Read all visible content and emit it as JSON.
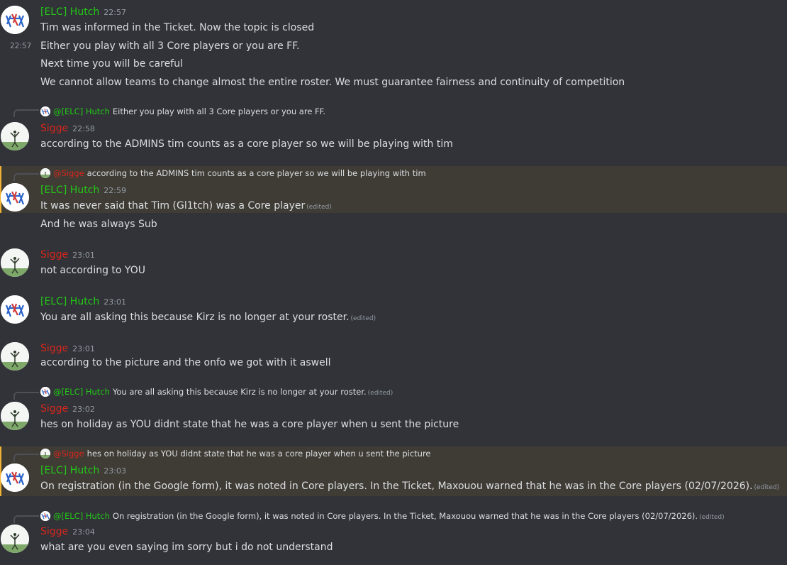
{
  "colors": {
    "hutch": "#23c916",
    "sigge": "#d6261c",
    "mention_bg": "#3f3c36"
  },
  "icons": {
    "hutch_avatar": "elc-logo-icon",
    "sigge_avatar": "person-field-icon"
  },
  "messages": [
    {
      "author": "[ELC] Hutch",
      "time": "22:57",
      "lines": [
        "Tim was informed in the Ticket. Now the topic is closed",
        "Either you play with all 3 Core players or you are FF.",
        "Next time you will be careful",
        "We cannot allow teams to change almost the entire roster. We must guarantee fairness and continuity of competition"
      ],
      "hover_time": "22:57"
    },
    {
      "reply": {
        "author": "@[ELC] Hutch",
        "text": "Either you play with all 3 Core players or you are FF."
      },
      "author": "Sigge",
      "time": "22:58",
      "lines": [
        "according to the ADMINS tim counts as a core player so we will be playing with tim"
      ]
    },
    {
      "reply": {
        "author": "@Sigge",
        "text": "according to the ADMINS tim counts as a core player so we will be playing with tim"
      },
      "author": "[ELC] Hutch",
      "time": "22:59",
      "lines": [
        "It was never said that Tim (Gl1tch) was a Core player",
        "And he was always Sub"
      ],
      "edited": "(edited)"
    },
    {
      "author": "Sigge",
      "time": "23:01",
      "lines": [
        "not according to YOU"
      ]
    },
    {
      "author": "[ELC] Hutch",
      "time": "23:01",
      "lines": [
        "You are all asking this because Kirz is no longer at your roster."
      ],
      "edited": "(edited)"
    },
    {
      "author": "Sigge",
      "time": "23:01",
      "lines": [
        "according to the picture and the onfo we got with it aswell"
      ]
    },
    {
      "reply": {
        "author": "@[ELC] Hutch",
        "text": "You are all asking this because Kirz is no longer at your roster.",
        "edited": "(edited)"
      },
      "author": "Sigge",
      "time": "23:02",
      "lines": [
        "hes on holiday as YOU didnt state that he was a core player when u sent the picture"
      ]
    },
    {
      "reply": {
        "author": "@Sigge",
        "text": "hes on holiday as YOU didnt state that he was a core player when u sent the picture"
      },
      "author": "[ELC] Hutch",
      "time": "23:03",
      "lines": [
        "On registration (in the Google form), it was noted in Core players. In the Ticket, Maxouou warned that he was in the Core players (02/07/2026)."
      ],
      "edited": "(edited)"
    },
    {
      "reply": {
        "author": "@[ELC] Hutch",
        "text": "On registration (in the Google form), it was noted in Core players. In the Ticket, Maxouou warned that he was in the Core players (02/07/2026).",
        "edited": "(edited)"
      },
      "author": "Sigge",
      "time": "23:04",
      "lines": [
        "what are you even saying im sorry but i do not understand"
      ]
    }
  ]
}
